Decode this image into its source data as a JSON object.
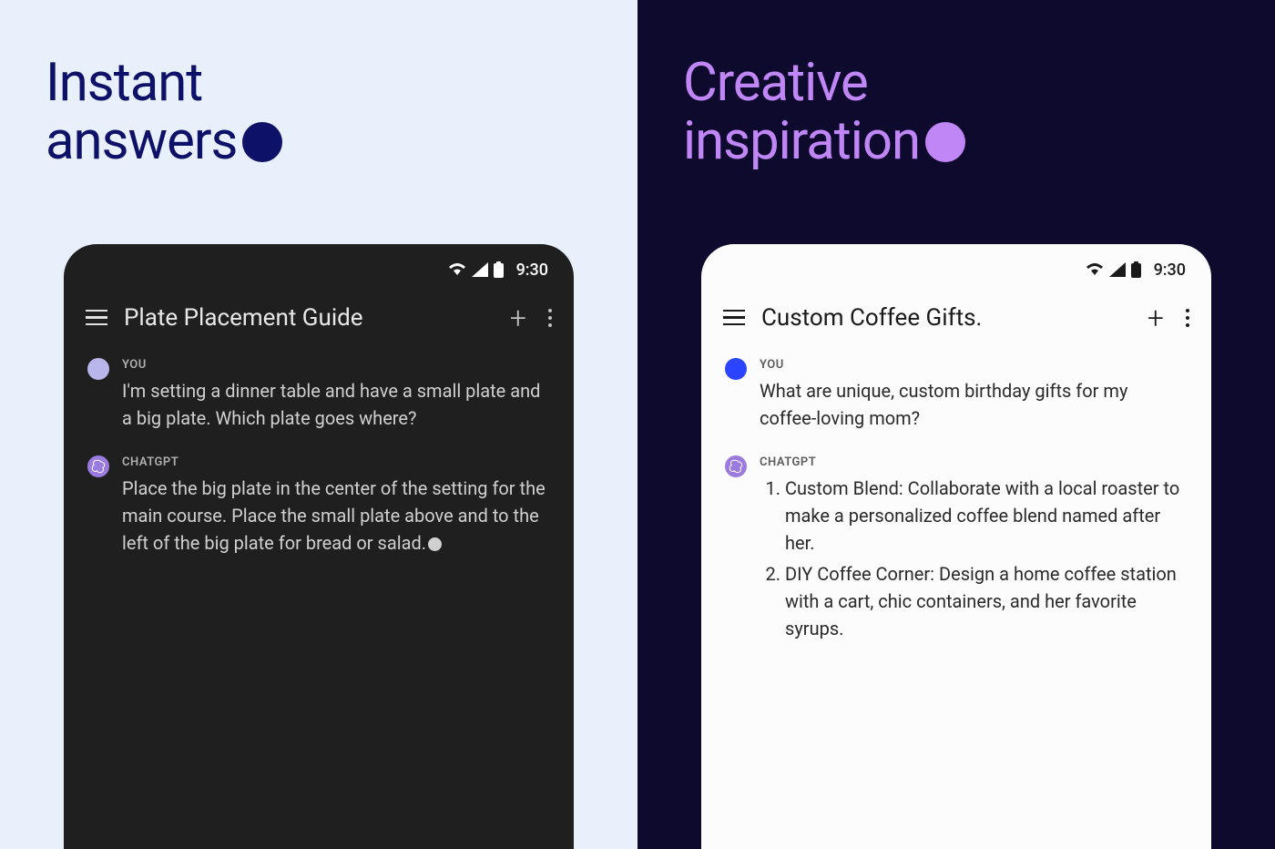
{
  "left": {
    "heading_line1": "Instant",
    "heading_line2": "answers",
    "phone": {
      "status_time": "9:30",
      "header_title": "Plate Placement Guide",
      "messages": {
        "user": {
          "sender": "YOU",
          "text": "I'm setting a dinner table and have a small plate and a big plate. Which plate goes where?"
        },
        "assistant": {
          "sender": "CHATGPT",
          "text": "Place the big plate in the center of the setting for the main course. Place the small plate above and to the left of the big plate for bread or salad."
        }
      }
    }
  },
  "right": {
    "heading_line1": "Creative",
    "heading_line2": "inspiration",
    "phone": {
      "status_time": "9:30",
      "header_title": "Custom Coffee Gifts.",
      "messages": {
        "user": {
          "sender": "YOU",
          "text": "What are unique, custom birthday gifts for my coffee-loving mom?"
        },
        "assistant": {
          "sender": "CHATGPT",
          "items": [
            "Custom Blend: Collaborate with a local roaster to make a personalized coffee blend named after her.",
            "DIY Coffee Corner: Design a home coffee station with a cart, chic containers, and her favorite syrups."
          ]
        }
      }
    }
  }
}
